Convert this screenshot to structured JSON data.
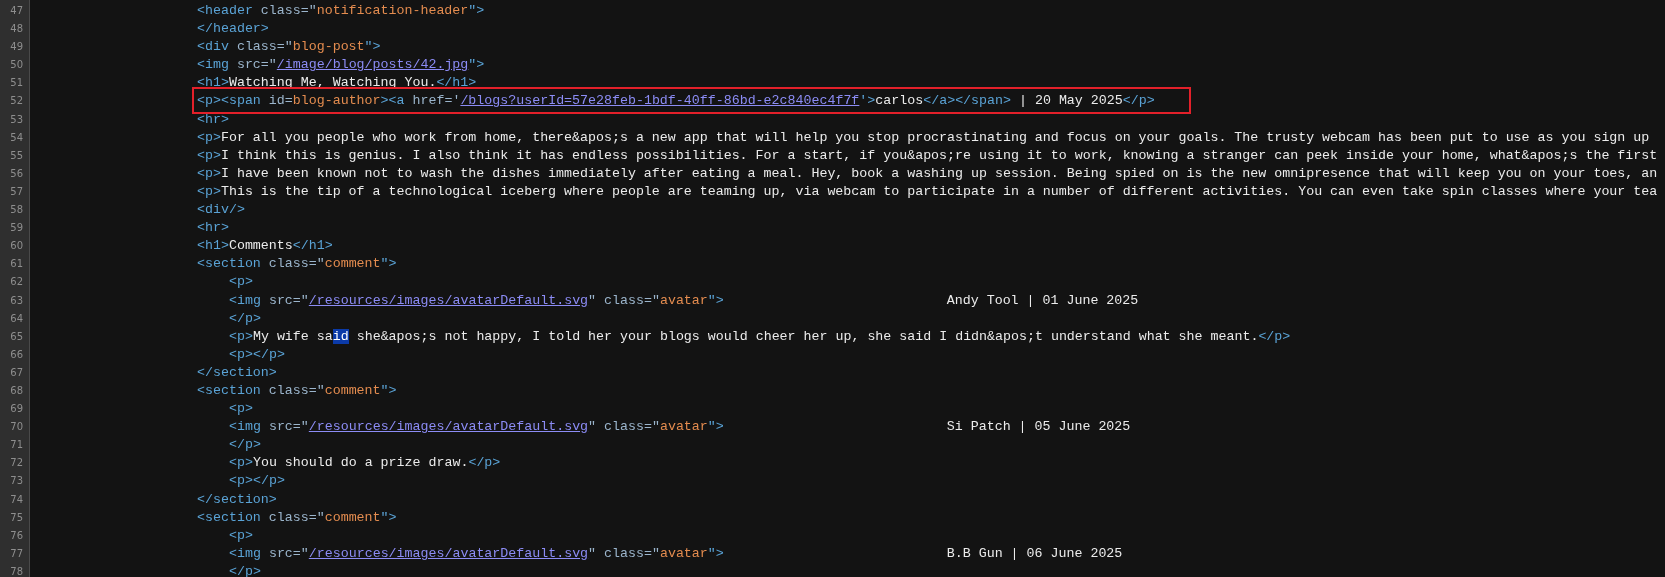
{
  "source_view": {
    "lines": [
      {
        "number": "47",
        "boxed": false,
        "tokens": [
          {
            "kind": "tag",
            "text": "<header "
          },
          {
            "kind": "attr",
            "text": "class=\""
          },
          {
            "kind": "value",
            "text": "notification-header"
          },
          {
            "kind": "tag",
            "text": "\">"
          }
        ]
      },
      {
        "number": "48",
        "boxed": false,
        "tokens": [
          {
            "kind": "tag",
            "text": "</header>"
          }
        ]
      },
      {
        "number": "49",
        "boxed": false,
        "tokens": [
          {
            "kind": "tag",
            "text": "<div "
          },
          {
            "kind": "attr",
            "text": "class=\""
          },
          {
            "kind": "value",
            "text": "blog-post"
          },
          {
            "kind": "tag",
            "text": "\">"
          }
        ]
      },
      {
        "number": "50",
        "boxed": false,
        "tokens": [
          {
            "kind": "tag",
            "text": "<img "
          },
          {
            "kind": "attr",
            "text": "src=\""
          },
          {
            "kind": "link",
            "text": "/image/blog/posts/42.jpg"
          },
          {
            "kind": "tag",
            "text": "\">"
          }
        ]
      },
      {
        "number": "51",
        "boxed": false,
        "tokens": [
          {
            "kind": "tag",
            "text": "<h1>"
          },
          {
            "kind": "text",
            "text": "Watching Me, Watching You."
          },
          {
            "kind": "tag",
            "text": "</h1>"
          }
        ]
      },
      {
        "number": "52",
        "boxed": true,
        "tokens": [
          {
            "kind": "tag",
            "text": "<p><span "
          },
          {
            "kind": "attr",
            "text": "id="
          },
          {
            "kind": "value",
            "text": "blog-author"
          },
          {
            "kind": "tag",
            "text": "><a "
          },
          {
            "kind": "attr",
            "text": "href='"
          },
          {
            "kind": "link",
            "text": "/blogs?userId=57e28feb-1bdf-40ff-86bd-e2c840ec4f7f"
          },
          {
            "kind": "tag",
            "text": "'>"
          },
          {
            "kind": "text",
            "text": "carlos"
          },
          {
            "kind": "tag",
            "text": "</a></span>"
          },
          {
            "kind": "text",
            "text": " | 20 May 2025"
          },
          {
            "kind": "tag",
            "text": "</p>"
          }
        ]
      },
      {
        "number": "53",
        "boxed": false,
        "tokens": [
          {
            "kind": "tag",
            "text": "<hr>"
          }
        ]
      },
      {
        "number": "54",
        "boxed": false,
        "tokens": [
          {
            "kind": "tag",
            "text": "<p>"
          },
          {
            "kind": "text",
            "text": "For all you people who work from home, there&apos;s a new app that will help you stop procrastinating and focus on your goals. The trusty webcam has been put to use as you sign up"
          }
        ]
      },
      {
        "number": "55",
        "boxed": false,
        "tokens": [
          {
            "kind": "tag",
            "text": "<p>"
          },
          {
            "kind": "text",
            "text": "I think this is genius. I also think it has endless possibilities. For a start, if you&apos;re using it to work, knowing a stranger can peek inside your home, what&apos;s the first"
          }
        ]
      },
      {
        "number": "56",
        "boxed": false,
        "tokens": [
          {
            "kind": "tag",
            "text": "<p>"
          },
          {
            "kind": "text",
            "text": "I have been known not to wash the dishes immediately after eating a meal. Hey, book a washing up session. Being spied on is the new omnipresence that will keep you on your toes, an"
          }
        ]
      },
      {
        "number": "57",
        "boxed": false,
        "tokens": [
          {
            "kind": "tag",
            "text": "<p>"
          },
          {
            "kind": "text",
            "text": "This is the tip of a technological iceberg where people are teaming up, via webcam to participate in a number of different activities. You can even take spin classes where your tea"
          }
        ]
      },
      {
        "number": "58",
        "boxed": false,
        "tokens": [
          {
            "kind": "tag",
            "text": "<div/>"
          }
        ]
      },
      {
        "number": "59",
        "boxed": false,
        "tokens": [
          {
            "kind": "tag",
            "text": "<hr>"
          }
        ]
      },
      {
        "number": "60",
        "boxed": false,
        "tokens": [
          {
            "kind": "tag",
            "text": "<h1>"
          },
          {
            "kind": "text",
            "text": "Comments"
          },
          {
            "kind": "tag",
            "text": "</h1>"
          }
        ]
      },
      {
        "number": "61",
        "boxed": false,
        "tokens": [
          {
            "kind": "tag",
            "text": "<section "
          },
          {
            "kind": "attr",
            "text": "class=\""
          },
          {
            "kind": "value",
            "text": "comment"
          },
          {
            "kind": "tag",
            "text": "\">"
          }
        ],
        "children": [
          {
            "number": "62",
            "boxed": false,
            "tokens": [
              {
                "kind": "tag",
                "text": "<p>"
              }
            ]
          },
          {
            "number": "63",
            "boxed": false,
            "tokens": [
              {
                "kind": "tag",
                "text": "<img "
              },
              {
                "kind": "attr",
                "text": "src=\""
              },
              {
                "kind": "link",
                "text": "/resources/images/avatarDefault.svg"
              },
              {
                "kind": "attr",
                "text": "\" class=\""
              },
              {
                "kind": "value",
                "text": "avatar"
              },
              {
                "kind": "tag",
                "text": "\">"
              },
              {
                "kind": "aside",
                "text": "Andy Tool | 01 June 2025"
              }
            ]
          },
          {
            "number": "64",
            "boxed": false,
            "tokens": [
              {
                "kind": "tag",
                "text": "</p>"
              }
            ]
          },
          {
            "number": "65",
            "boxed": false,
            "tokens": [
              {
                "kind": "tag",
                "text": "<p>"
              },
              {
                "kind": "text",
                "text": "My wife sa"
              },
              {
                "kind": "selection",
                "text": "id"
              },
              {
                "kind": "text",
                "text": " she&apos;s not happy, I told her your blogs would cheer her up, she said I didn&apos;t understand what she meant."
              },
              {
                "kind": "tag",
                "text": "</p>"
              }
            ]
          },
          {
            "number": "66",
            "boxed": false,
            "tokens": [
              {
                "kind": "tag",
                "text": "<p></p>"
              }
            ]
          }
        ]
      },
      {
        "number": "67",
        "boxed": false,
        "tokens": [
          {
            "kind": "tag",
            "text": "</section>"
          }
        ]
      },
      {
        "number": "68",
        "boxed": false,
        "tokens": [
          {
            "kind": "tag",
            "text": "<section "
          },
          {
            "kind": "attr",
            "text": "class=\""
          },
          {
            "kind": "value",
            "text": "comment"
          },
          {
            "kind": "tag",
            "text": "\">"
          }
        ],
        "children": [
          {
            "number": "69",
            "boxed": false,
            "tokens": [
              {
                "kind": "tag",
                "text": "<p>"
              }
            ]
          },
          {
            "number": "70",
            "boxed": false,
            "tokens": [
              {
                "kind": "tag",
                "text": "<img "
              },
              {
                "kind": "attr",
                "text": "src=\""
              },
              {
                "kind": "link",
                "text": "/resources/images/avatarDefault.svg"
              },
              {
                "kind": "attr",
                "text": "\" class=\""
              },
              {
                "kind": "value",
                "text": "avatar"
              },
              {
                "kind": "tag",
                "text": "\">"
              },
              {
                "kind": "aside",
                "text": "Si Patch | 05 June 2025"
              }
            ]
          },
          {
            "number": "71",
            "boxed": false,
            "tokens": [
              {
                "kind": "tag",
                "text": "</p>"
              }
            ]
          },
          {
            "number": "72",
            "boxed": false,
            "tokens": [
              {
                "kind": "tag",
                "text": "<p>"
              },
              {
                "kind": "text",
                "text": "You should do a prize draw."
              },
              {
                "kind": "tag",
                "text": "</p>"
              }
            ]
          },
          {
            "number": "73",
            "boxed": false,
            "tokens": [
              {
                "kind": "tag",
                "text": "<p></p>"
              }
            ]
          }
        ]
      },
      {
        "number": "74",
        "boxed": false,
        "tokens": [
          {
            "kind": "tag",
            "text": "</section>"
          }
        ]
      },
      {
        "number": "75",
        "boxed": false,
        "tokens": [
          {
            "kind": "tag",
            "text": "<section "
          },
          {
            "kind": "attr",
            "text": "class=\""
          },
          {
            "kind": "value",
            "text": "comment"
          },
          {
            "kind": "tag",
            "text": "\">"
          }
        ],
        "children": [
          {
            "number": "76",
            "boxed": false,
            "tokens": [
              {
                "kind": "tag",
                "text": "<p>"
              }
            ]
          },
          {
            "number": "77",
            "boxed": false,
            "tokens": [
              {
                "kind": "tag",
                "text": "<img "
              },
              {
                "kind": "attr",
                "text": "src=\""
              },
              {
                "kind": "link",
                "text": "/resources/images/avatarDefault.svg"
              },
              {
                "kind": "attr",
                "text": "\" class=\""
              },
              {
                "kind": "value",
                "text": "avatar"
              },
              {
                "kind": "tag",
                "text": "\">"
              },
              {
                "kind": "aside",
                "text": "B.B Gun | 06 June 2025"
              }
            ]
          },
          {
            "number": "78",
            "boxed": false,
            "tokens": [
              {
                "kind": "tag",
                "text": "</p>"
              }
            ]
          }
        ]
      }
    ]
  }
}
